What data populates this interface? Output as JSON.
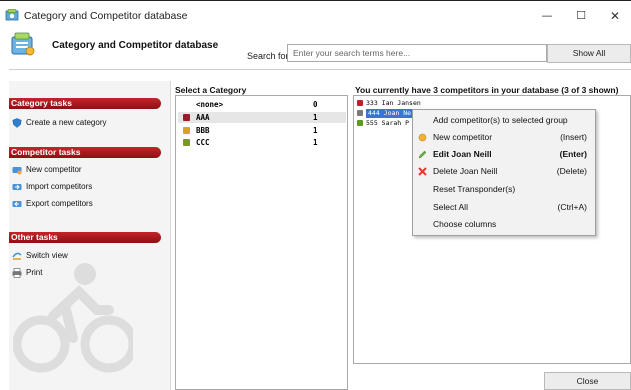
{
  "window": {
    "title": "Category and Competitor database",
    "minimize_glyph": "—",
    "maximize_glyph": "☐",
    "close_glyph": "✕"
  },
  "header": {
    "title": "Category and Competitor database",
    "search_label": "Search for:",
    "search_placeholder": "Enter your search terms here...",
    "search_value": "",
    "show_all_label": "Show All"
  },
  "task_panel": {
    "groups": [
      {
        "title": "Category tasks",
        "items": [
          {
            "label": "Create a new category",
            "icon": "category-shield-icon"
          }
        ]
      },
      {
        "title": "Competitor  tasks",
        "items": [
          {
            "label": "New competitor",
            "icon": "new-competitor-icon"
          },
          {
            "label": "Import competitors",
            "icon": "import-icon"
          },
          {
            "label": "Export competitors",
            "icon": "export-icon"
          }
        ]
      },
      {
        "title": "Other tasks",
        "items": [
          {
            "label": "Switch view",
            "icon": "switch-view-icon"
          },
          {
            "label": "Print",
            "icon": "printer-icon"
          }
        ]
      }
    ]
  },
  "categories": {
    "title": "Select a Category",
    "rows": [
      {
        "name": "<none>",
        "count": "0",
        "color": "",
        "selected": false
      },
      {
        "name": "AAA",
        "count": "1",
        "color": "#9b1c2c",
        "selected": true
      },
      {
        "name": "BBB",
        "count": "1",
        "color": "#d9a31c",
        "selected": false
      },
      {
        "name": "CCC",
        "count": "1",
        "color": "#7a9a1e",
        "selected": false
      }
    ]
  },
  "competitors": {
    "title": "You currently have 3 competitors in your database (3 of 3 shown)",
    "rows": [
      {
        "text": "333 Ian Jansen",
        "color": "#c11f2e",
        "selected": false
      },
      {
        "text": "444 Joan Ne",
        "color": "#7a7a7a",
        "selected": true
      },
      {
        "text": "555 Sarah P",
        "color": "#5b9a1e",
        "selected": false
      }
    ]
  },
  "context_menu": {
    "items": [
      {
        "label": "Add competitor(s) to selected group",
        "shortcut": "",
        "bold": false,
        "icon": ""
      },
      {
        "label": "New competitor",
        "shortcut": "(Insert)",
        "bold": false,
        "icon": "new-star-icon"
      },
      {
        "label": "Edit Joan Neill",
        "shortcut": "(Enter)",
        "bold": true,
        "icon": "edit-pencil-icon"
      },
      {
        "label": "Delete Joan Neill",
        "shortcut": "(Delete)",
        "bold": false,
        "icon": "delete-x-icon"
      },
      {
        "label": "Reset Transponder(s)",
        "shortcut": "",
        "bold": false,
        "icon": ""
      },
      {
        "label": "Select All",
        "shortcut": "(Ctrl+A)",
        "bold": false,
        "icon": ""
      },
      {
        "label": "Choose columns",
        "shortcut": "",
        "bold": false,
        "icon": ""
      }
    ]
  },
  "footer": {
    "close_label": "Close"
  },
  "colors": {
    "accent_red": "#b01c22",
    "selection_blue": "#3b74d2"
  }
}
